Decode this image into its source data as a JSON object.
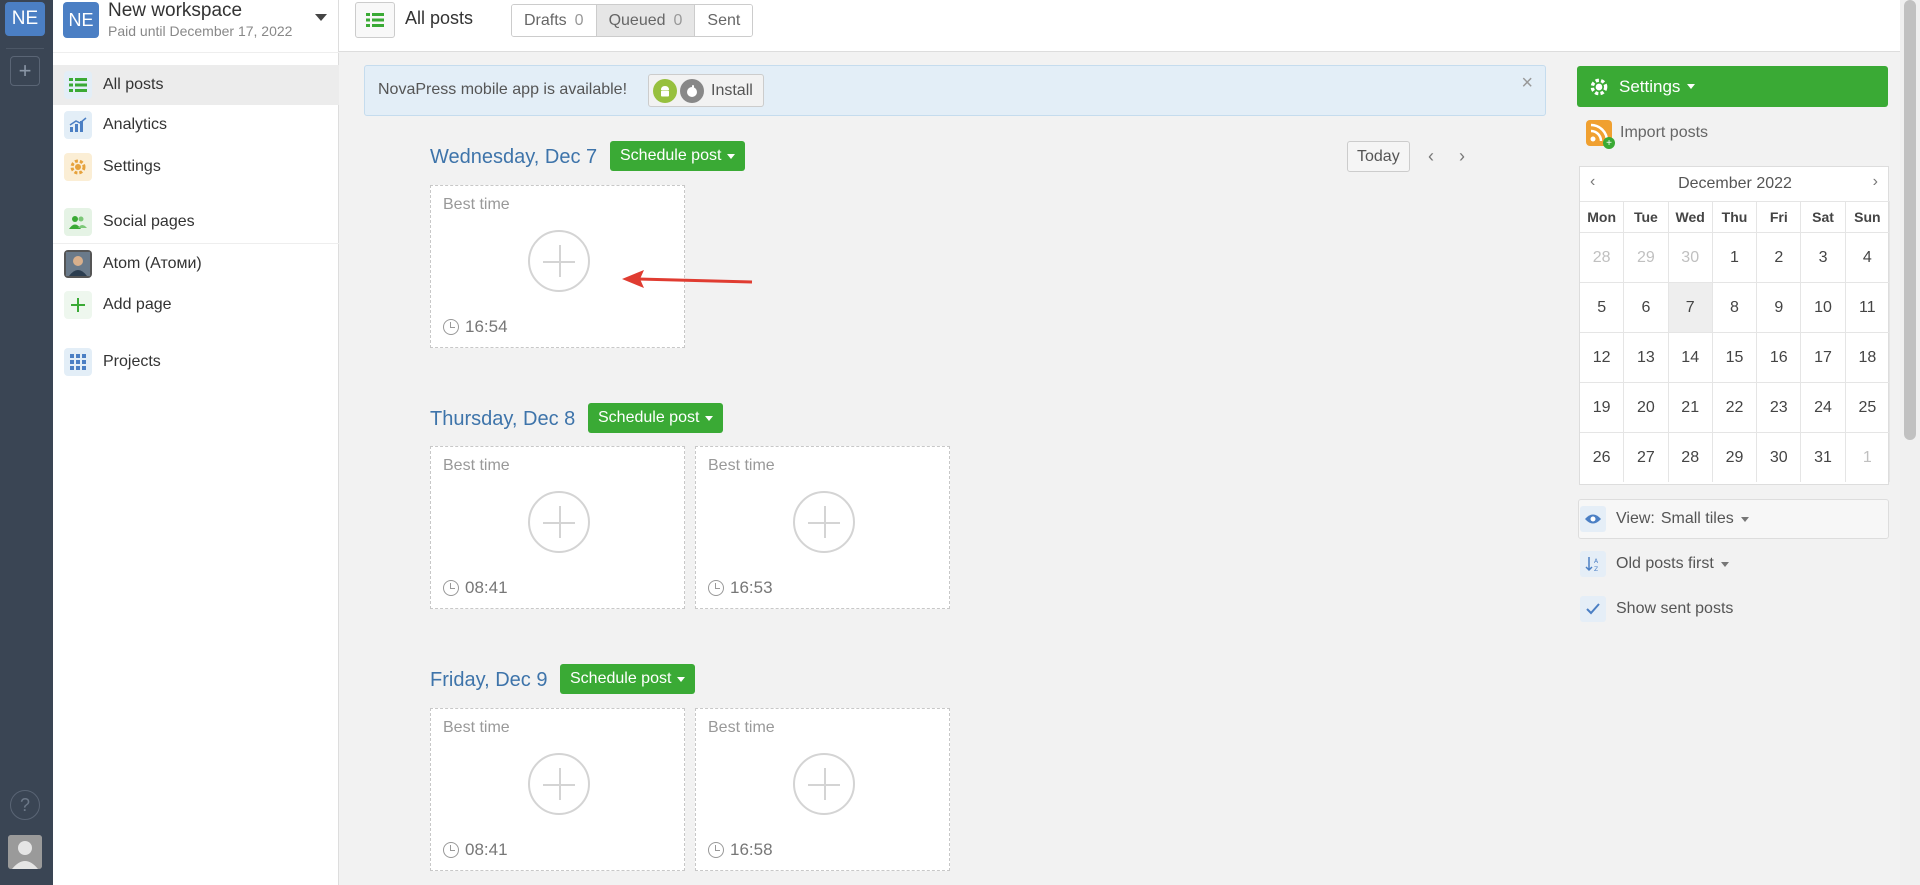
{
  "rail": {
    "workspace_badge": "NE",
    "add_icon": "plus-icon",
    "help_symbol": "?"
  },
  "workspace": {
    "badge": "NE",
    "name": "New workspace",
    "paid_until": "Paid until December 17, 2022"
  },
  "sidebar": {
    "items": [
      {
        "label": "All posts",
        "icon": "list-icon"
      },
      {
        "label": "Analytics",
        "icon": "bar-chart-icon"
      },
      {
        "label": "Settings",
        "icon": "gear-icon"
      },
      {
        "label": "Social pages",
        "icon": "users-icon"
      },
      {
        "label": "Atom (Атоми)",
        "icon": "avatar"
      },
      {
        "label": "Add page",
        "icon": "plus-icon"
      },
      {
        "label": "Projects",
        "icon": "grid-icon"
      }
    ]
  },
  "topbar": {
    "title": "All posts",
    "tabs": [
      {
        "label": "Drafts",
        "count": "0"
      },
      {
        "label": "Queued",
        "count": "0"
      },
      {
        "label": "Sent",
        "count": ""
      }
    ]
  },
  "banner": {
    "message": "NovaPress mobile app is available!",
    "install_label": "Install",
    "close_symbol": "×"
  },
  "schedule_label": "Schedule post",
  "best_time_label": "Best time",
  "days": [
    {
      "label": "Wednesday, Dec 7",
      "slots": [
        "16:54"
      ]
    },
    {
      "label": "Thursday, Dec 8",
      "slots": [
        "08:41",
        "16:53"
      ]
    },
    {
      "label": "Friday, Dec 9",
      "slots": [
        "08:41",
        "16:58"
      ]
    }
  ],
  "nav": {
    "today_label": "Today",
    "prev": "‹",
    "next": "›"
  },
  "right": {
    "settings_label": "Settings",
    "import_label": "Import posts",
    "calendar": {
      "month": "December 2022",
      "prev": "‹",
      "next": "›",
      "weekdays": [
        "Mon",
        "Tue",
        "Wed",
        "Thu",
        "Fri",
        "Sat",
        "Sun"
      ],
      "days": [
        "28",
        "29",
        "30",
        "1",
        "2",
        "3",
        "4",
        "5",
        "6",
        "7",
        "8",
        "9",
        "10",
        "11",
        "12",
        "13",
        "14",
        "15",
        "16",
        "17",
        "18",
        "19",
        "20",
        "21",
        "22",
        "23",
        "24",
        "25",
        "26",
        "27",
        "28",
        "29",
        "30",
        "31",
        "1"
      ],
      "muted": [
        0,
        1,
        2,
        34
      ],
      "selected": 9
    },
    "view_prefix": "View:",
    "view_value": "Small tiles",
    "sort_label": "Old posts first",
    "show_sent_label": "Show sent posts"
  },
  "colors": {
    "accent_green": "#3aaa35",
    "link_blue": "#3e74aa",
    "workspace_blue": "#4b7fc4"
  }
}
